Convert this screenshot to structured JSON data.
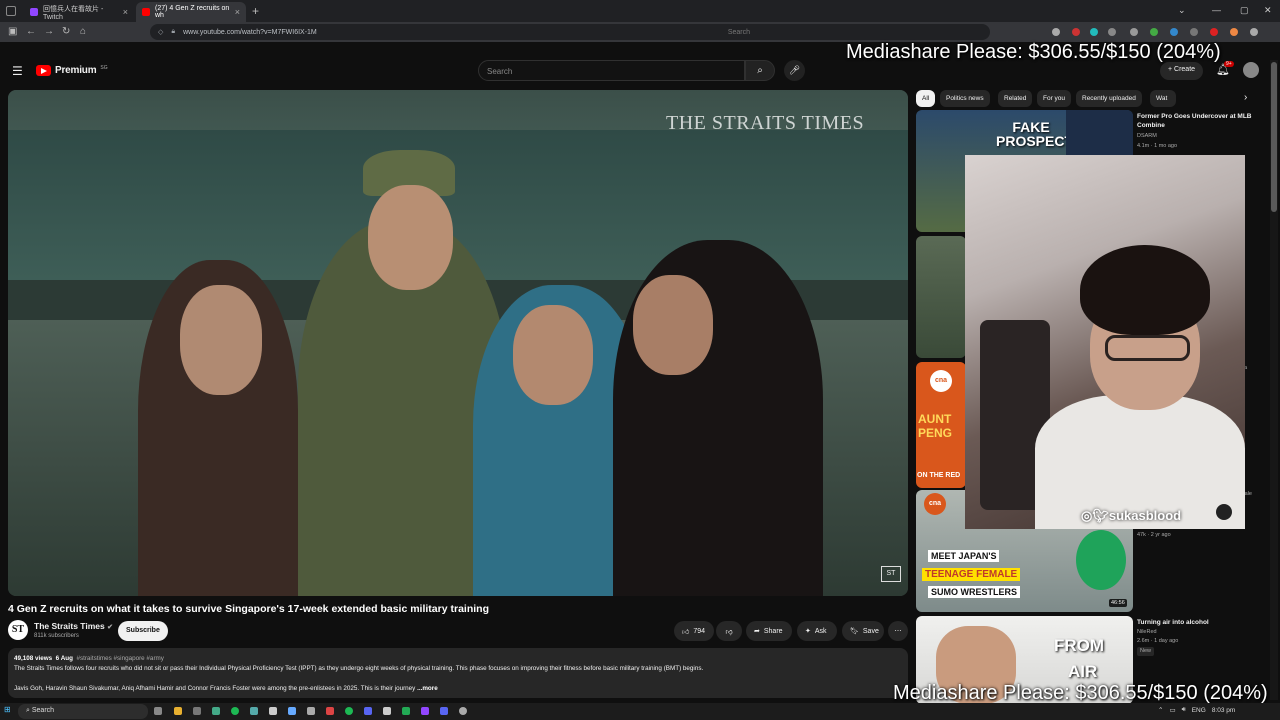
{
  "browser": {
    "tabs": [
      {
        "label": "回憶兵人在看故片 - Twitch"
      },
      {
        "label": "(27) 4 Gen Z recruits on wh"
      }
    ],
    "new_tab": "+",
    "close": "×",
    "url": "www.youtube.com/watch?v=M7FWI6IX-1M",
    "search_placeholder": "Search"
  },
  "youtube": {
    "logo_text": "Premium",
    "logo_country": "SG",
    "search_placeholder": "Search",
    "create_label": "+ Create",
    "notif_count": "9+"
  },
  "overlay": {
    "mediashare_top": "Mediashare Please: $306.55/$150 (204%)",
    "mediashare_bottom": "Mediashare Please: $306.55/$150 (204%)",
    "cam_handle": "sukasblood"
  },
  "video": {
    "watermark": "THE STRAITS TIMES",
    "corner_logo": "ST",
    "title": "4 Gen Z recruits on what it takes to survive Singapore's 17-week extended basic military training",
    "channel": "The Straits Times",
    "channel_icon": "ST",
    "subscribers": "811k subscribers",
    "subscribe": "Subscribe",
    "likes": "794",
    "share": "Share",
    "ask": "Ask",
    "save": "Save",
    "desc_views": "49,108 views",
    "desc_date": "6 Aug",
    "desc_tags": "#straitstimes #singapore #army",
    "desc_line1": "The Straits Times follows four recruits who did not sit or pass their Individual Physical Proficiency Test (IPPT) as they undergo eight weeks of physical training. This phase focuses on improving their fitness before basic military training (BMT) begins.",
    "desc_line2": "Javis Goh, Haravin Shaun Sivakumar, Aniq Afhami Hamir and Connor Francis Foster were among the pre-enlistees in 2025. This is their journey",
    "desc_more": "...more"
  },
  "sidebar": {
    "chips": [
      "All",
      "Politics news",
      "Related",
      "For you",
      "Recently uploaded",
      "Wat"
    ],
    "items": [
      {
        "title": "Former Pro Goes Undercover at MLB Combine",
        "channel": "DSARM",
        "meta": "4.1m · 1 mo ago",
        "thumb_text": "FAKE PROSPECT"
      },
      {
        "title": "",
        "channel": "",
        "meta": "",
        "thumb_text": ""
      },
      {
        "title": "",
        "channel": "",
        "meta": "",
        "thumb_text": "AUNT PENG",
        "thumb_sub": "ON THE RED",
        "logo": "cna"
      },
      {
        "title": "",
        "channel": "",
        "meta": "47k · 2 yr ago",
        "thumb_text": "MEET JAPAN'S TEENAGE FEMALE SUMO WRESTLERS",
        "thumb_l1": "MEET JAPAN'S",
        "thumb_l2": "TEENAGE FEMALE",
        "thumb_l3": "SUMO WRESTLERS",
        "duration": "46:56",
        "logo": "cna"
      },
      {
        "title": "Turning air into alcohol",
        "channel": "NileRed",
        "meta": "2.6m · 1 day ago",
        "badge": "New",
        "thumb_text": "FROM AIR",
        "thumb_l1": "FROM",
        "thumb_l2": "AIR"
      }
    ],
    "cut_text_1": "a",
    "cut_text_2": "male"
  },
  "taskbar": {
    "search": "Search",
    "lang": "ENG",
    "time": "8:03 pm"
  }
}
